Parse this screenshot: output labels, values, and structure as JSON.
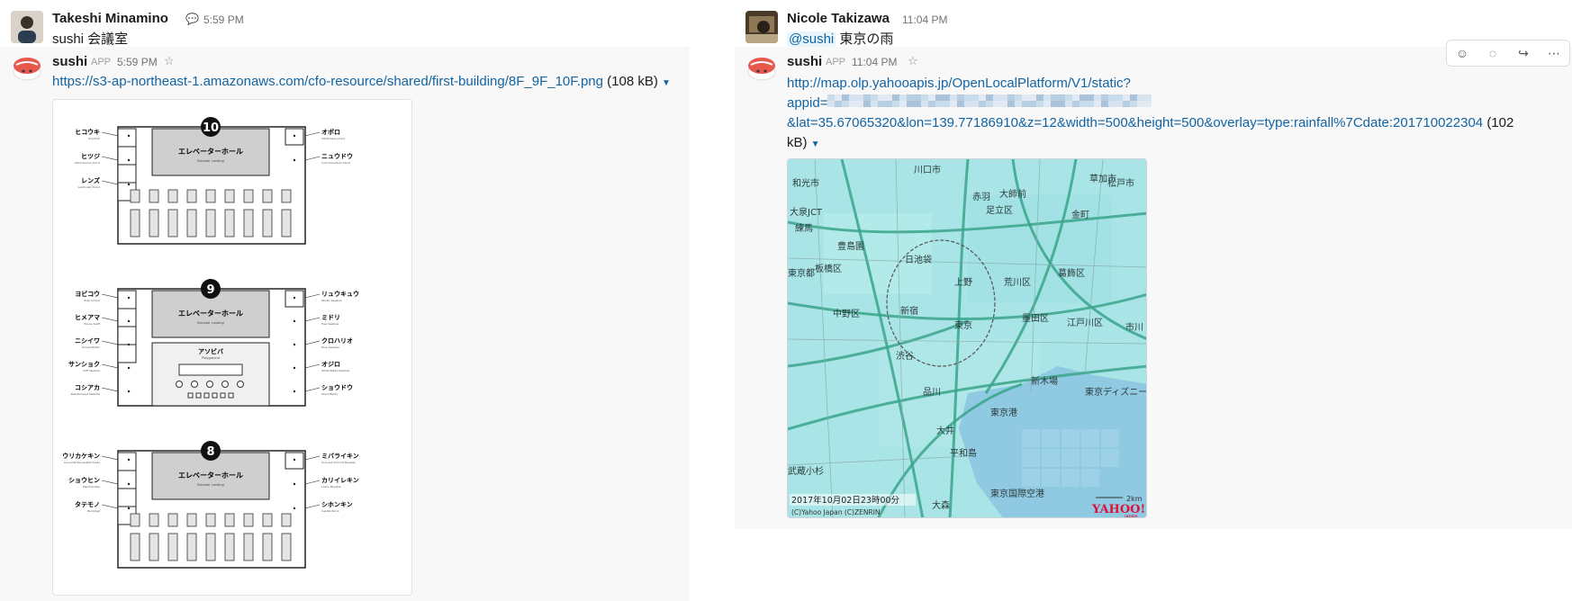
{
  "left": {
    "user_message": {
      "author": "Takeshi Minamino",
      "time": "5:59 PM",
      "text": "sushi 会議室"
    },
    "bot_message": {
      "author": "sushi",
      "app_badge": "APP",
      "time": "5:59 PM",
      "link": "https://s3-ap-northeast-1.amazonaws.com/cfo-resource/shared/first-building/8F_9F_10F.png",
      "size": "(108 kB)"
    },
    "floorplan": {
      "floors": [
        {
          "number": "10",
          "hall": "エレベーターホール",
          "hall_sub": "Elevator Landing",
          "left_labels": [
            {
              "jp": "ヒコウキ",
              "en": "Overtrail"
            },
            {
              "jp": "ヒツジ",
              "en": "Altocumulus Cloud"
            },
            {
              "jp": "レンズ",
              "en": "Lenticular Cloud"
            }
          ],
          "right_labels": [
            {
              "jp": "オボロ",
              "en": "Altostratus Cloud"
            },
            {
              "jp": "ニュウドウ",
              "en": "Cumulonimbus Cloud"
            }
          ]
        },
        {
          "number": "9",
          "hall": "エレベーターホール",
          "hall_sub": "Elevator Landing",
          "room": "アソビバ",
          "room_sub": "Playground",
          "left_labels": [
            {
              "jp": "ヨビコウ",
              "en": "Prep School"
            },
            {
              "jp": "ヒメアマ",
              "en": "House Swift"
            },
            {
              "jp": "ニシイワ",
              "en": "House Martin"
            },
            {
              "jp": "サンショク",
              "en": "Cliff Swallow"
            },
            {
              "jp": "コシアカ",
              "en": "Red-Rumped Swallow"
            }
          ],
          "right_labels": [
            {
              "jp": "リュウキュウ",
              "en": "Pacific Swallow"
            },
            {
              "jp": "ミドリ",
              "en": "Tree Swallow"
            },
            {
              "jp": "クロハリオ",
              "en": "Dive Swallow"
            },
            {
              "jp": "オジロ",
              "en": "White-Tailed Swallow"
            },
            {
              "jp": "ショウドウ",
              "en": "Sand Martin"
            }
          ]
        },
        {
          "number": "8",
          "hall": "エレベーターホール",
          "hall_sub": "Elevator Landing",
          "left_labels": [
            {
              "jp": "ウリカケキン",
              "en": "Accounts Receivable Trade"
            },
            {
              "jp": "ショウヒン",
              "en": "Merchandise"
            },
            {
              "jp": "タテモノ",
              "en": "Buildings"
            }
          ],
          "right_labels": [
            {
              "jp": "ミバライキン",
              "en": "Accrued Amount Payable"
            },
            {
              "jp": "カリイレキン",
              "en": "Loans Payable"
            },
            {
              "jp": "シホンキン",
              "en": "Capital Stock"
            }
          ]
        }
      ]
    }
  },
  "right": {
    "user_message": {
      "author": "Nicole Takizawa",
      "time": "11:04 PM",
      "mention": "@sushi",
      "text": "東京の雨"
    },
    "bot_message": {
      "author": "sushi",
      "app_badge": "APP",
      "time": "11:04 PM",
      "link_line1": "http://map.olp.yahooapis.jp/OpenLocalPlatform/V1/static?",
      "link_line2_prefix": "appid=",
      "link_line3": "&lat=35.67065320&lon=139.77186910&z=12&width=500&height=500&overlay=type:rainfall%7Cdate:201710022304",
      "size_part1": "(102",
      "size_part2": "kB)"
    },
    "map": {
      "timestamp": "2017年10月02日23時00分",
      "copyright": "(C)Yahoo Japan (C)ZENRIN",
      "scale": "2km",
      "logo": "YAHOO!",
      "logo_sub": "JAPAN",
      "labels": [
        "和光市",
        "川口市",
        "草加市",
        "松戸市",
        "大泉JCT",
        "練馬",
        "赤羽",
        "足立区",
        "大師前",
        "金町",
        "豊島園",
        "板橋区",
        "日池袋",
        "荒川区",
        "葛飾区",
        "東京都",
        "上野",
        "新宿",
        "中野区",
        "東京",
        "墨田区",
        "江戸川区",
        "渋谷",
        "品川",
        "新木場",
        "東京港",
        "東京ディズニー",
        "大井",
        "東京国際空港",
        "武蔵小杉",
        "平和島",
        "大森",
        "市川"
      ]
    },
    "toolbar_icons": [
      "add-reaction-icon",
      "reply-thread-icon",
      "share-icon",
      "more-icon"
    ]
  }
}
